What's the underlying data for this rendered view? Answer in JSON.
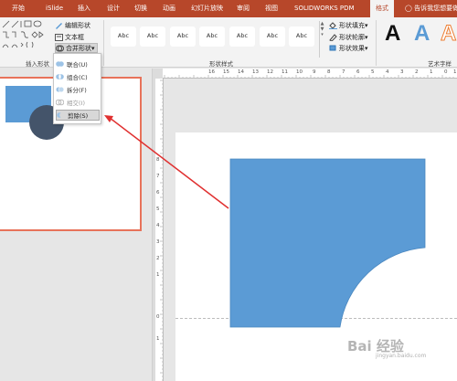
{
  "ribbon_tabs": [
    {
      "label": "开始"
    },
    {
      "label": "iSlide"
    },
    {
      "label": "插入"
    },
    {
      "label": "设计"
    },
    {
      "label": "切换"
    },
    {
      "label": "动画"
    },
    {
      "label": "幻灯片放映"
    },
    {
      "label": "审阅"
    },
    {
      "label": "视图"
    },
    {
      "label": "SOLIDWORKS PDM"
    },
    {
      "label": "格式"
    }
  ],
  "tell_me": "告诉我您想要做",
  "insert_shapes": {
    "group_label": "插入形状",
    "edit_shape": "编辑形状",
    "text_box": "文本框",
    "merge_shapes": "合并形状"
  },
  "shape_styles": {
    "group_label": "形状样式",
    "preset_label": "Abc",
    "preset_colors": [
      "#333333",
      "#5b9bd5",
      "#ed7d31",
      "#a5a5a5",
      "#ffc000",
      "#4472c4",
      "#70ad47"
    ],
    "fill": "形状填充",
    "outline": "形状轮廓",
    "effects": "形状效果"
  },
  "wordart": {
    "group_label": "艺术字样",
    "sample": "A",
    "colors": [
      "#111111",
      "#5b9bd5",
      "#ed7d31"
    ]
  },
  "merge_menu": {
    "items": [
      {
        "label": "联合(U)",
        "enabled": true,
        "selected": false
      },
      {
        "label": "组合(C)",
        "enabled": true,
        "selected": false
      },
      {
        "label": "拆分(F)",
        "enabled": true,
        "selected": false
      },
      {
        "label": "相交(I)",
        "enabled": false,
        "selected": false
      },
      {
        "label": "剪除(S)",
        "enabled": true,
        "selected": true
      }
    ]
  },
  "hruler_labels": [
    "16",
    "15",
    "14",
    "13",
    "12",
    "11",
    "10",
    "9",
    "8",
    "7",
    "6",
    "5",
    "4",
    "3",
    "2",
    "1",
    "0",
    "1"
  ],
  "vruler_labels": [
    "8",
    "7",
    "6",
    "5",
    "4",
    "3",
    "2",
    "1",
    "0",
    "1"
  ],
  "colors": {
    "ribbon": "#b7472a",
    "shape_fill": "#5b9bd5",
    "circle_fill": "#44546a",
    "thumb_border": "#e8725a",
    "arrow": "#e03030"
  },
  "watermark": {
    "brand": "Bai 经验",
    "url": "jingyan.baidu.com"
  }
}
